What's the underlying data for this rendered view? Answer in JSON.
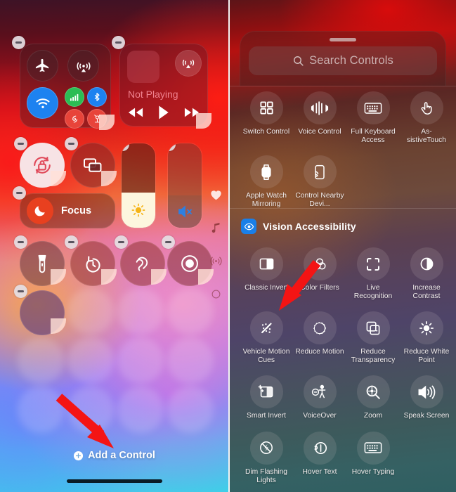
{
  "left_panel": {
    "name": "Control Center — edit mode",
    "connectivity_module": {
      "buttons": [
        {
          "label": "Airplane Mode",
          "icon": "airplane-icon",
          "state": "off"
        },
        {
          "label": "AirDrop",
          "icon": "airdrop-icon",
          "state": "off"
        },
        {
          "label": "Wi-Fi",
          "icon": "wifi-icon",
          "state": "on"
        },
        {
          "label": "Cellular Data",
          "icon": "cellular-icon",
          "state": "on"
        },
        {
          "label": "Bluetooth",
          "icon": "bluetooth-icon",
          "state": "on"
        },
        {
          "label": "Personal Hotspot",
          "icon": "hotspot-icon",
          "state": "on"
        },
        {
          "label": "SharePlay",
          "icon": "satellite-icon",
          "state": "on"
        }
      ]
    },
    "media_module": {
      "status": "Not Playing",
      "airplay_icon": "airplay-icon",
      "transport": [
        {
          "label": "Rewind",
          "icon": "rewind-icon"
        },
        {
          "label": "Play",
          "icon": "play-icon"
        },
        {
          "label": "Fast Forward",
          "icon": "forward-icon"
        }
      ]
    },
    "toggles": [
      {
        "label": "Rotation Lock",
        "icon": "rotation-lock-icon",
        "state": "on"
      },
      {
        "label": "Screen Mirroring",
        "icon": "screen-mirroring-icon",
        "state": "off"
      },
      {
        "label": "Flashlight",
        "icon": "flashlight-icon",
        "state": "off"
      },
      {
        "label": "Timer",
        "icon": "timer-icon",
        "state": "off"
      },
      {
        "label": "Hearing",
        "icon": "hearing-icon",
        "state": "off"
      },
      {
        "label": "Screen Recording",
        "icon": "screen-record-icon",
        "state": "off"
      },
      {
        "label": "Empty Control",
        "icon": "blank-icon",
        "state": "off"
      }
    ],
    "focus": {
      "label": "Focus",
      "icon": "moon-icon"
    },
    "brightness_slider": {
      "label": "Brightness",
      "icon": "sun-icon",
      "value_percent": 42
    },
    "volume_slider": {
      "label": "Volume",
      "icon": "mute-icon",
      "value_percent": 0,
      "muted": true
    },
    "page_dots": [
      {
        "label": "Favorites",
        "icon": "heart-icon"
      },
      {
        "label": "Now Playing",
        "icon": "music-note-icon"
      },
      {
        "label": "Connectivity",
        "icon": "broadcast-icon"
      },
      {
        "label": "More",
        "icon": "circle-icon"
      }
    ],
    "add_control": {
      "label": "Add a Control",
      "icon": "plus-circle-icon"
    },
    "annotation_arrow": {
      "color": "#f41414",
      "points_to": "Add a Control"
    }
  },
  "right_panel": {
    "name": "Add a Control gallery",
    "search": {
      "placeholder": "Search Controls",
      "value": "",
      "icon": "search-icon"
    },
    "sections": [
      {
        "title": "",
        "badge_icon": "",
        "items": [
          {
            "label": "Switch Control",
            "icon": "switch-control-icon"
          },
          {
            "label": "Voice Control",
            "icon": "voice-control-icon"
          },
          {
            "label": "Full Keyboard Access",
            "icon": "keyboard-icon"
          },
          {
            "label": "As-\nsistiveTouch",
            "icon": "assistive-touch-icon"
          },
          {
            "label": "Apple Watch Mirroring",
            "icon": "apple-watch-icon"
          },
          {
            "label": "Control Nearby Devi...",
            "icon": "nearby-devices-icon"
          }
        ]
      },
      {
        "title": "Vision Accessibility",
        "badge_icon": "eye-icon",
        "badge_color": "#1a7fe8",
        "items": [
          {
            "label": "Classic Invert",
            "icon": "classic-invert-icon"
          },
          {
            "label": "Color Filters",
            "icon": "color-filters-icon"
          },
          {
            "label": "Live Recognition",
            "icon": "live-recognition-icon"
          },
          {
            "label": "Increase Contrast",
            "icon": "increase-contrast-icon"
          },
          {
            "label": "Vehicle Motion Cues",
            "icon": "vehicle-motion-cues-icon"
          },
          {
            "label": "Reduce Motion",
            "icon": "reduce-motion-icon"
          },
          {
            "label": "Reduce Transparency",
            "icon": "reduce-transparency-icon"
          },
          {
            "label": "Reduce White Point",
            "icon": "reduce-white-point-icon"
          },
          {
            "label": "Smart Invert",
            "icon": "smart-invert-icon"
          },
          {
            "label": "VoiceOver",
            "icon": "voiceover-icon"
          },
          {
            "label": "Zoom",
            "icon": "zoom-icon"
          },
          {
            "label": "Speak Screen",
            "icon": "speak-screen-icon"
          },
          {
            "label": "Dim Flashing Lights",
            "icon": "dim-flashing-lights-icon"
          },
          {
            "label": "Hover Text",
            "icon": "hover-text-icon"
          },
          {
            "label": "Hover Typing",
            "icon": "hover-typing-icon"
          }
        ]
      }
    ],
    "annotation_arrow": {
      "color": "#f41414",
      "points_to": "Vehicle Motion Cues"
    }
  }
}
